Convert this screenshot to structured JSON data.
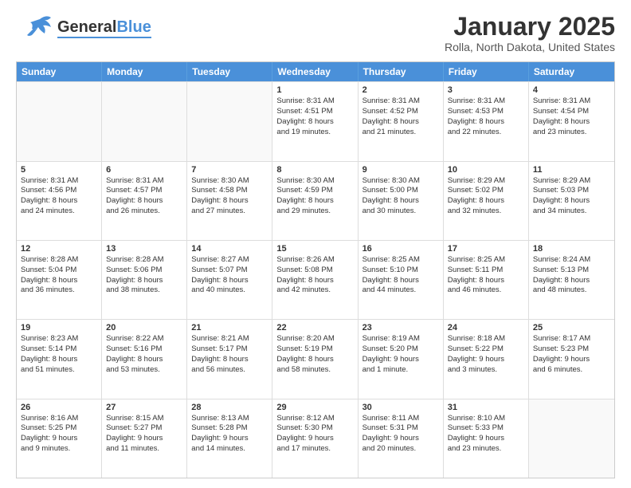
{
  "header": {
    "logo_general": "General",
    "logo_blue": "Blue",
    "month_title": "January 2025",
    "location": "Rolla, North Dakota, United States"
  },
  "weekdays": [
    "Sunday",
    "Monday",
    "Tuesday",
    "Wednesday",
    "Thursday",
    "Friday",
    "Saturday"
  ],
  "rows": [
    [
      {
        "day": "",
        "text": ""
      },
      {
        "day": "",
        "text": ""
      },
      {
        "day": "",
        "text": ""
      },
      {
        "day": "1",
        "text": "Sunrise: 8:31 AM\nSunset: 4:51 PM\nDaylight: 8 hours\nand 19 minutes."
      },
      {
        "day": "2",
        "text": "Sunrise: 8:31 AM\nSunset: 4:52 PM\nDaylight: 8 hours\nand 21 minutes."
      },
      {
        "day": "3",
        "text": "Sunrise: 8:31 AM\nSunset: 4:53 PM\nDaylight: 8 hours\nand 22 minutes."
      },
      {
        "day": "4",
        "text": "Sunrise: 8:31 AM\nSunset: 4:54 PM\nDaylight: 8 hours\nand 23 minutes."
      }
    ],
    [
      {
        "day": "5",
        "text": "Sunrise: 8:31 AM\nSunset: 4:56 PM\nDaylight: 8 hours\nand 24 minutes."
      },
      {
        "day": "6",
        "text": "Sunrise: 8:31 AM\nSunset: 4:57 PM\nDaylight: 8 hours\nand 26 minutes."
      },
      {
        "day": "7",
        "text": "Sunrise: 8:30 AM\nSunset: 4:58 PM\nDaylight: 8 hours\nand 27 minutes."
      },
      {
        "day": "8",
        "text": "Sunrise: 8:30 AM\nSunset: 4:59 PM\nDaylight: 8 hours\nand 29 minutes."
      },
      {
        "day": "9",
        "text": "Sunrise: 8:30 AM\nSunset: 5:00 PM\nDaylight: 8 hours\nand 30 minutes."
      },
      {
        "day": "10",
        "text": "Sunrise: 8:29 AM\nSunset: 5:02 PM\nDaylight: 8 hours\nand 32 minutes."
      },
      {
        "day": "11",
        "text": "Sunrise: 8:29 AM\nSunset: 5:03 PM\nDaylight: 8 hours\nand 34 minutes."
      }
    ],
    [
      {
        "day": "12",
        "text": "Sunrise: 8:28 AM\nSunset: 5:04 PM\nDaylight: 8 hours\nand 36 minutes."
      },
      {
        "day": "13",
        "text": "Sunrise: 8:28 AM\nSunset: 5:06 PM\nDaylight: 8 hours\nand 38 minutes."
      },
      {
        "day": "14",
        "text": "Sunrise: 8:27 AM\nSunset: 5:07 PM\nDaylight: 8 hours\nand 40 minutes."
      },
      {
        "day": "15",
        "text": "Sunrise: 8:26 AM\nSunset: 5:08 PM\nDaylight: 8 hours\nand 42 minutes."
      },
      {
        "day": "16",
        "text": "Sunrise: 8:25 AM\nSunset: 5:10 PM\nDaylight: 8 hours\nand 44 minutes."
      },
      {
        "day": "17",
        "text": "Sunrise: 8:25 AM\nSunset: 5:11 PM\nDaylight: 8 hours\nand 46 minutes."
      },
      {
        "day": "18",
        "text": "Sunrise: 8:24 AM\nSunset: 5:13 PM\nDaylight: 8 hours\nand 48 minutes."
      }
    ],
    [
      {
        "day": "19",
        "text": "Sunrise: 8:23 AM\nSunset: 5:14 PM\nDaylight: 8 hours\nand 51 minutes."
      },
      {
        "day": "20",
        "text": "Sunrise: 8:22 AM\nSunset: 5:16 PM\nDaylight: 8 hours\nand 53 minutes."
      },
      {
        "day": "21",
        "text": "Sunrise: 8:21 AM\nSunset: 5:17 PM\nDaylight: 8 hours\nand 56 minutes."
      },
      {
        "day": "22",
        "text": "Sunrise: 8:20 AM\nSunset: 5:19 PM\nDaylight: 8 hours\nand 58 minutes."
      },
      {
        "day": "23",
        "text": "Sunrise: 8:19 AM\nSunset: 5:20 PM\nDaylight: 9 hours\nand 1 minute."
      },
      {
        "day": "24",
        "text": "Sunrise: 8:18 AM\nSunset: 5:22 PM\nDaylight: 9 hours\nand 3 minutes."
      },
      {
        "day": "25",
        "text": "Sunrise: 8:17 AM\nSunset: 5:23 PM\nDaylight: 9 hours\nand 6 minutes."
      }
    ],
    [
      {
        "day": "26",
        "text": "Sunrise: 8:16 AM\nSunset: 5:25 PM\nDaylight: 9 hours\nand 9 minutes."
      },
      {
        "day": "27",
        "text": "Sunrise: 8:15 AM\nSunset: 5:27 PM\nDaylight: 9 hours\nand 11 minutes."
      },
      {
        "day": "28",
        "text": "Sunrise: 8:13 AM\nSunset: 5:28 PM\nDaylight: 9 hours\nand 14 minutes."
      },
      {
        "day": "29",
        "text": "Sunrise: 8:12 AM\nSunset: 5:30 PM\nDaylight: 9 hours\nand 17 minutes."
      },
      {
        "day": "30",
        "text": "Sunrise: 8:11 AM\nSunset: 5:31 PM\nDaylight: 9 hours\nand 20 minutes."
      },
      {
        "day": "31",
        "text": "Sunrise: 8:10 AM\nSunset: 5:33 PM\nDaylight: 9 hours\nand 23 minutes."
      },
      {
        "day": "",
        "text": ""
      }
    ]
  ]
}
